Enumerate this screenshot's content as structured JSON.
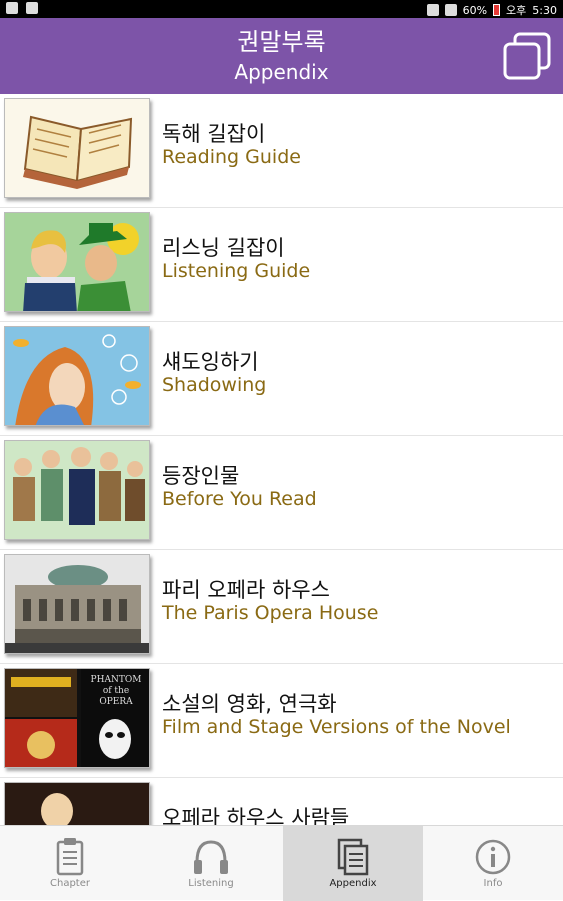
{
  "status_bar": {
    "battery": "60%",
    "ampm": "오후",
    "time": "5:30"
  },
  "header": {
    "title_ko": "권말부록",
    "title_en": "Appendix"
  },
  "items": [
    {
      "title_ko": "독해 길잡이",
      "title_en": "Reading Guide"
    },
    {
      "title_ko": "리스닝 길잡이",
      "title_en": "Listening Guide"
    },
    {
      "title_ko": "섀도잉하기",
      "title_en": "Shadowing"
    },
    {
      "title_ko": "등장인물",
      "title_en": "Before You Read"
    },
    {
      "title_ko": "파리 오페라 하우스",
      "title_en": "The Paris Opera House"
    },
    {
      "title_ko": "소설의 영화, 연극화",
      "title_en": "Film and Stage Versions of the Novel",
      "poster_text": "PHANTOM of the OPERA"
    },
    {
      "title_ko": "오페라 하우스 사람들",
      "title_en": ""
    }
  ],
  "tabs": [
    {
      "label": "Chapter"
    },
    {
      "label": "Listening"
    },
    {
      "label": "Appendix",
      "active": true
    },
    {
      "label": "Info"
    }
  ],
  "colors": {
    "header_bg": "#7d54a8",
    "subtitle": "#8a6a14",
    "active_tab_bg": "#d9d9d9"
  }
}
